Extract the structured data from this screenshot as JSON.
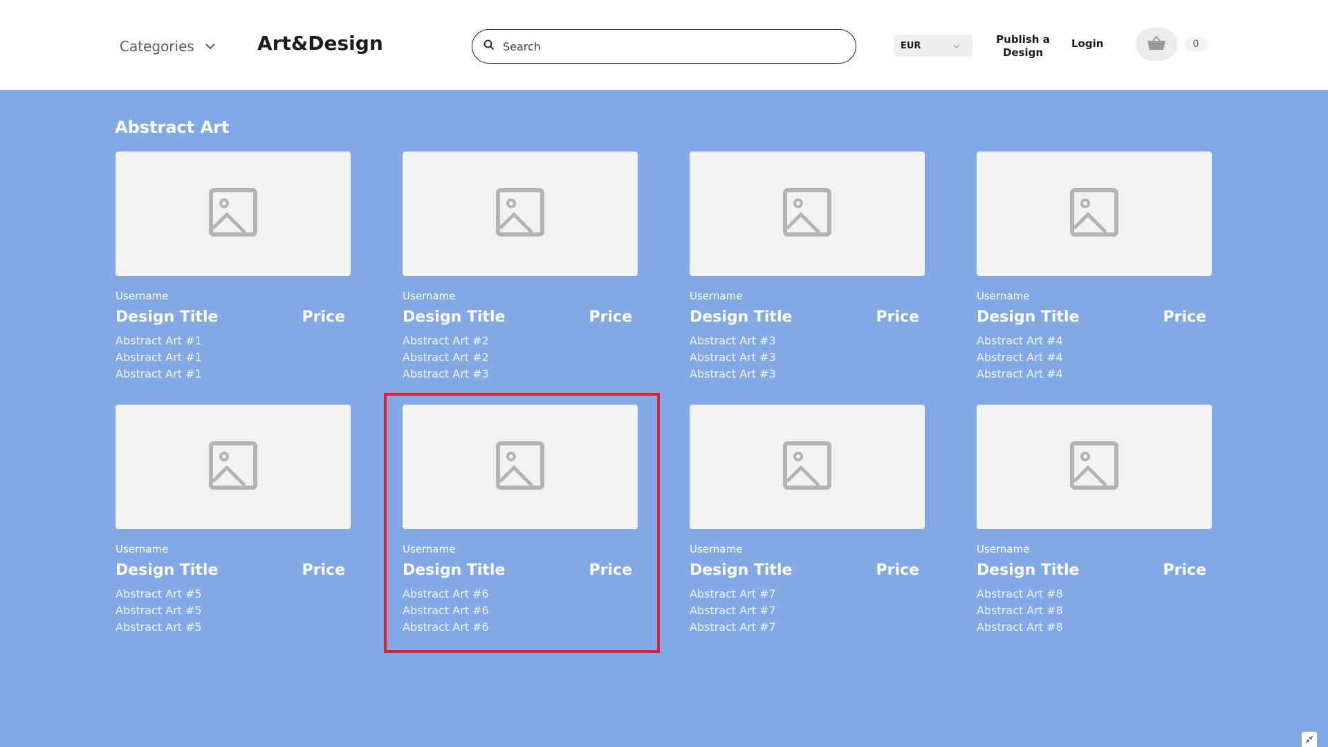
{
  "header": {
    "categories_label": "Categories",
    "brand": "Art&Design",
    "search_placeholder": "Search",
    "currency": "EUR",
    "publish_label": "Publish a Design",
    "login_label": "Login",
    "cart_count": "0"
  },
  "section": {
    "title": "Abstract Art"
  },
  "cards": [
    {
      "username": "Username",
      "title": "Design Title",
      "price": "Price",
      "lines": [
        "Abstract Art #1",
        "Abstract Art #1",
        "Abstract Art #1"
      ]
    },
    {
      "username": "Username",
      "title": "Design Title",
      "price": "Price",
      "lines": [
        "Abstract Art #2",
        "Abstract Art #2",
        "Abstract Art #3"
      ]
    },
    {
      "username": "Username",
      "title": "Design Title",
      "price": "Price",
      "lines": [
        "Abstract Art #3",
        "Abstract Art #3",
        "Abstract Art #3"
      ]
    },
    {
      "username": "Username",
      "title": "Design Title",
      "price": "Price",
      "lines": [
        "Abstract Art #4",
        "Abstract Art #4",
        "Abstract Art #4"
      ]
    },
    {
      "username": "Username",
      "title": "Design Title",
      "price": "Price",
      "lines": [
        "Abstract Art #5",
        "Abstract Art #5",
        "Abstract Art #5"
      ]
    },
    {
      "username": "Username",
      "title": "Design Title",
      "price": "Price",
      "lines": [
        "Abstract Art #6",
        "Abstract Art #6",
        "Abstract Art #6"
      ]
    },
    {
      "username": "Username",
      "title": "Design Title",
      "price": "Price",
      "lines": [
        "Abstract Art #7",
        "Abstract Art #7",
        "Abstract Art #7"
      ]
    },
    {
      "username": "Username",
      "title": "Design Title",
      "price": "Price",
      "lines": [
        "Abstract Art #8",
        "Abstract Art #8",
        "Abstract Art #8"
      ]
    }
  ],
  "selected_card": 6,
  "icons": {
    "categories": "chevron-down-icon",
    "search": "search-icon",
    "currency": "chevron-down-icon",
    "cart": "basket-icon",
    "thumb": "image-placeholder-icon",
    "corner": "collapse-icon"
  },
  "colors": {
    "main_bg": "#82a9e5",
    "highlight": "#e11d2e",
    "thumb_bg": "#f2f2f2"
  }
}
